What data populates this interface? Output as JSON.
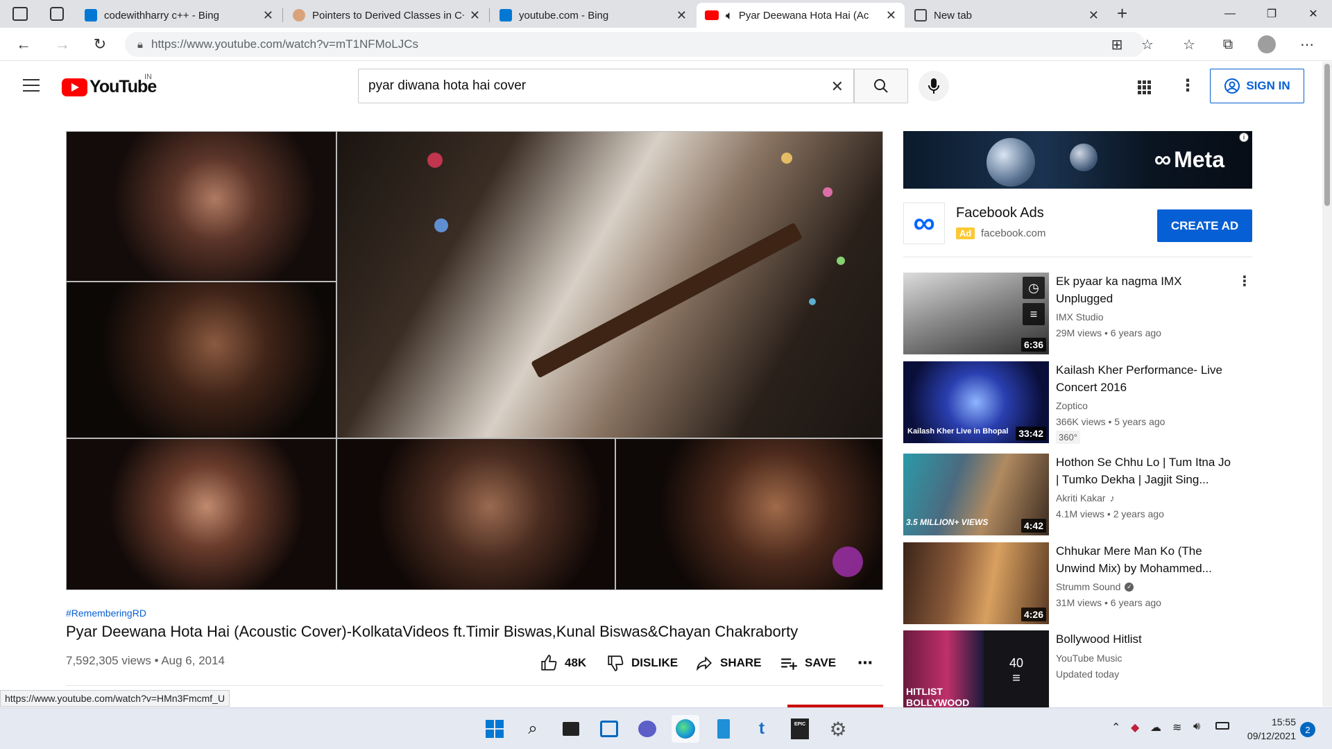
{
  "browser": {
    "tabs": [
      {
        "label": "codewithharry c++ - Bing",
        "active": false
      },
      {
        "label": "Pointers to Derived Classes in C+",
        "active": false
      },
      {
        "label": "youtube.com - Bing",
        "active": false
      },
      {
        "label": "Pyar Deewana Hota Hai (Ac",
        "active": true
      },
      {
        "label": "New tab",
        "active": false
      }
    ],
    "url": "https://www.youtube.com/watch?v=mT1NFMoLJCs",
    "status_url": "https://www.youtube.com/watch?v=HMn3Fmcmf_U"
  },
  "youtube": {
    "logo_text": "YouTube",
    "country": "IN",
    "search_query": "pyar diwana hota hai cover",
    "sign_in": "SIGN IN"
  },
  "video": {
    "hashtag": "#RememberingRD",
    "title": "Pyar Deewana Hota Hai (Acoustic Cover)-KolkataVideos ft.Timir Biswas,Kunal Biswas&Chayan Chakraborty",
    "meta": "7,592,305 views • Aug 6, 2014",
    "likes": "48K",
    "dislike": "DISLIKE",
    "share": "SHARE",
    "save": "SAVE"
  },
  "ad": {
    "banner_brand": "Meta",
    "title": "Facebook Ads",
    "badge": "Ad",
    "domain": "facebook.com",
    "cta": "CREATE AD"
  },
  "recommendations": [
    {
      "title": "Ek pyaar ka nagma IMX Unplugged",
      "channel": "IMX Studio",
      "verified": false,
      "meta": "29M views • 6 years ago",
      "duration": "6:36",
      "badge": ""
    },
    {
      "title": "Kailash Kher Performance- Live Concert 2016",
      "channel": "Zoptico",
      "verified": false,
      "meta": "366K views • 5 years ago",
      "duration": "33:42",
      "badge": "360°",
      "thumb_caption": "Kailash Kher Live in Bhopal"
    },
    {
      "title": "Hothon Se Chhu Lo | Tum Itna Jo | Tumko Dekha | Jagjit Sing...",
      "channel": "Akriti Kakar",
      "verified": false,
      "music": true,
      "meta": "4.1M views • 2 years ago",
      "duration": "4:42",
      "badge": "",
      "thumb_caption": "3.5 MILLION+ VIEWS"
    },
    {
      "title": "Chhukar Mere Man Ko (The Unwind Mix) by Mohammed...",
      "channel": "Strumm Sound",
      "verified": true,
      "meta": "31M views • 6 years ago",
      "duration": "4:26",
      "badge": ""
    },
    {
      "title": "Bollywood Hitlist",
      "channel": "YouTube Music",
      "verified": false,
      "meta": "Updated today",
      "duration": "",
      "playlist_count": "40",
      "badge": "",
      "thumb_caption": "HITLIST BOLLYWOOD"
    }
  ],
  "taskbar": {
    "time": "15:55",
    "date": "09/12/2021",
    "notifications": "2"
  }
}
